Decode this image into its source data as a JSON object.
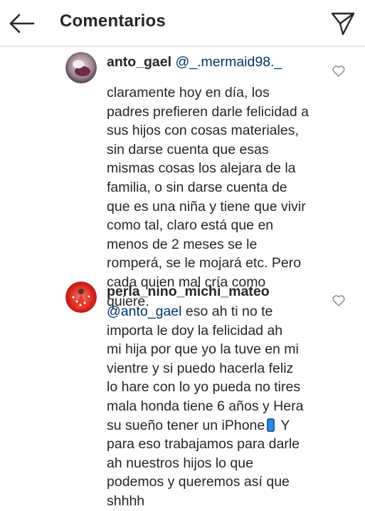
{
  "header": {
    "title": "Comentarios",
    "back_icon": "arrow-left-icon",
    "share_icon": "paper-plane-icon"
  },
  "comments": [
    {
      "username": "anto_gael",
      "mention": "@_.mermaid98._",
      "text": "claramente hoy en día, los\npadres prefieren darle felicidad a\nsus hijos con cosas materiales,\nsin darse cuenta que esas\nmismas cosas los alejara de la\nfamilia, o sin darse cuenta de\nque es una niña y tiene que vivir\ncomo tal, claro está que en\nmenos de 2 meses se le\nromperá,  se le mojará etc. Pero\ncada quien mal cría como\nquiere.",
      "like_icon": "heart-outline-icon"
    },
    {
      "username": "perla_nino_michi_mateo",
      "mention": "@anto_gael",
      "text_part1": "  eso ah ti no te\nimporta  le doy la felicidad  ah\nmi hija por que yo la tuve en mi\nvientre  y si puedo hacerla feliz\nlo hare con lo yo pueda no tires\nmala honda tiene 6 años y Hera\nsu sueño tener un iPhone",
      "emoji": "mobile-phone-emoji",
      "text_part2": "  Y\npara eso trabajamos para darle\nah nuestros hijos lo que\npodemos y queremos  así que\nshhhh",
      "like_icon": "heart-outline-icon"
    }
  ],
  "colors": {
    "text": "#262626",
    "mention": "#003569",
    "divider": "#dbdbdb"
  }
}
